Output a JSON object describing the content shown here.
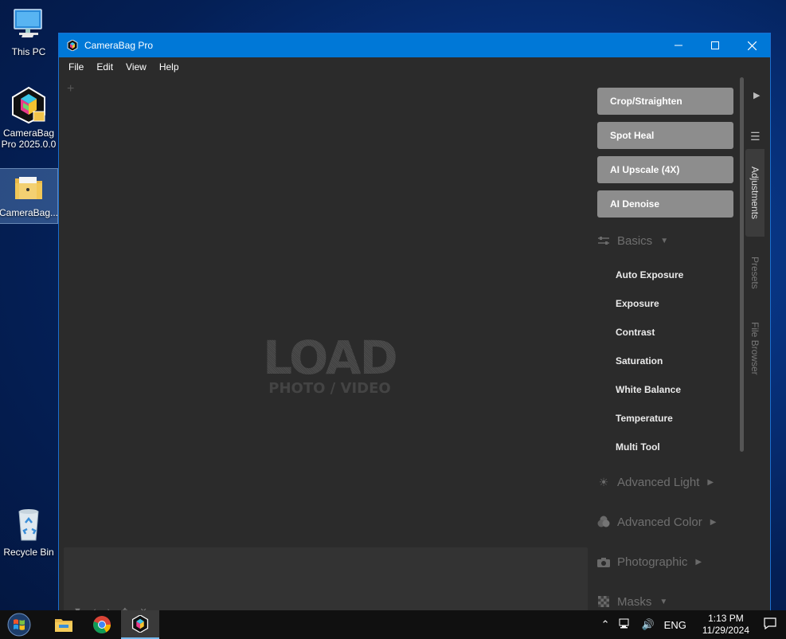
{
  "desktop": {
    "icons": [
      {
        "label": "This PC"
      },
      {
        "label": "CameraBag\nPro 2025.0.0"
      },
      {
        "label": "CameraBag..."
      },
      {
        "label": "Recycle Bin"
      }
    ]
  },
  "window": {
    "title": "CameraBag Pro",
    "menu": [
      "File",
      "Edit",
      "View",
      "Help"
    ],
    "canvas": {
      "load_title": "LOAD",
      "load_subtitle": "PHOTO / VIDEO"
    },
    "panel": {
      "tools": [
        "Crop/Straighten",
        "Spot Heal",
        "AI Upscale (4X)",
        "AI Denoise"
      ],
      "basics_label": "Basics",
      "basics_items": [
        "Auto Exposure",
        "Exposure",
        "Contrast",
        "Saturation",
        "White Balance",
        "Temperature",
        "Multi Tool"
      ],
      "sections": [
        {
          "label": "Advanced Light"
        },
        {
          "label": "Advanced Color"
        },
        {
          "label": "Photographic"
        },
        {
          "label": "Masks"
        }
      ]
    },
    "tabs": [
      "Adjustments",
      "Presets",
      "File Browser"
    ]
  },
  "taskbar": {
    "language": "ENG",
    "time": "1:13 PM",
    "date": "11/29/2024"
  }
}
